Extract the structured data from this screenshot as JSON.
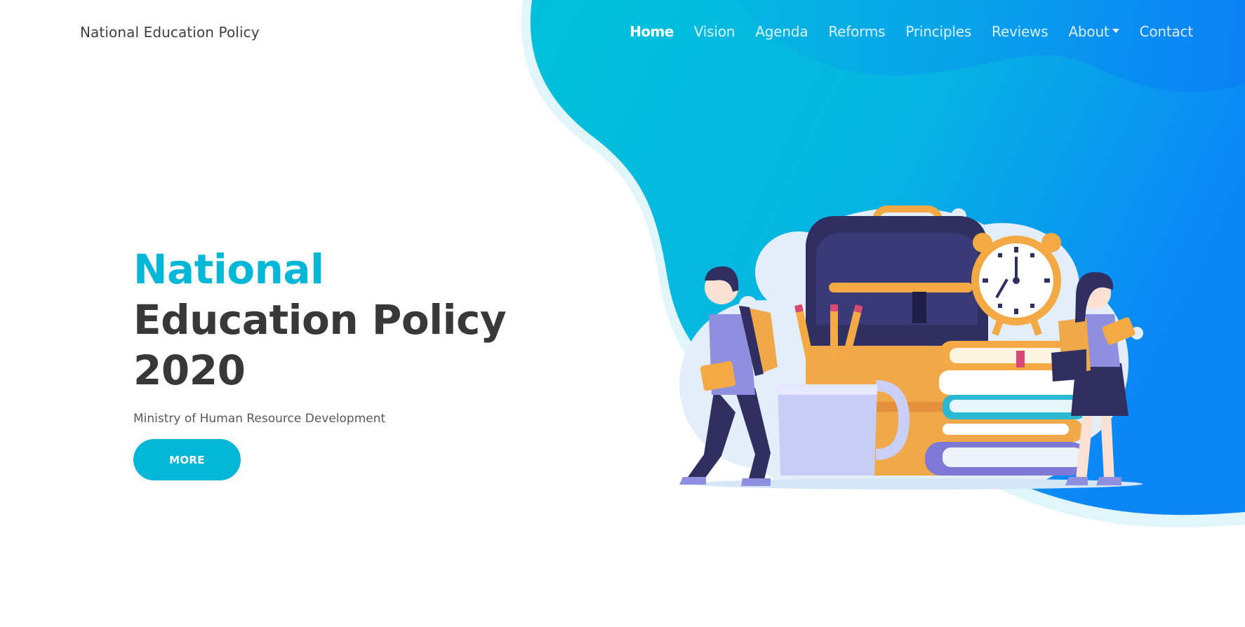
{
  "navbar": {
    "brand": "National Education Policy",
    "links": [
      {
        "label": "Home",
        "active": true
      },
      {
        "label": "Vision",
        "active": false
      },
      {
        "label": "Agenda",
        "active": false
      },
      {
        "label": "Reforms",
        "active": false
      },
      {
        "label": "Principles",
        "active": false
      },
      {
        "label": "Reviews",
        "active": false
      },
      {
        "label": "About",
        "active": false,
        "dropdown": true
      },
      {
        "label": "Contact",
        "active": false
      }
    ],
    "dropdown_icon": "caret-down-icon"
  },
  "hero": {
    "title_accent": "National",
    "title_line2": "Education Policy",
    "title_line3": "2020",
    "subtitle": "Ministry of Human Resource Development",
    "button_label": "MORE",
    "illustration": "students-backpack-books-clock-illustration"
  },
  "colors": {
    "accent": "#05b7d7",
    "blob_gradient_start": "#00c4d8",
    "blob_gradient_end": "#0a8ef5",
    "heading": "#383838",
    "text_muted": "#595959"
  }
}
